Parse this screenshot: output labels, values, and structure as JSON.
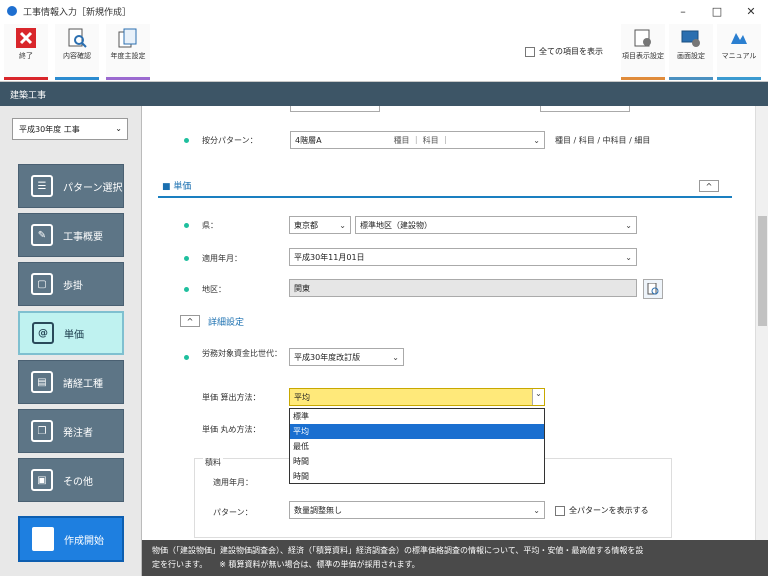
{
  "window": {
    "title": "工事情報入力［新規作成］",
    "controls": [
      "–",
      "□",
      "✕"
    ]
  },
  "toolbar": {
    "buttons": [
      {
        "label": "終了",
        "icon": "close-icon",
        "color": "#d9262b"
      },
      {
        "label": "内容確認",
        "icon": "preview-icon",
        "color": "#2b8bd0"
      },
      {
        "label": "年度主設定",
        "icon": "copy-settings-icon",
        "color": "#9b6ad0"
      }
    ],
    "show_all_label": "全ての項目を表示",
    "right_buttons": [
      {
        "label": "項目表示設定",
        "icon": "display-settings-icon",
        "color": "#e08b3a"
      },
      {
        "label": "画面設定",
        "icon": "screen-settings-icon",
        "color": "#4a90c0"
      },
      {
        "label": "マニュアル",
        "icon": "manual-icon",
        "color": "#3a9ad0"
      }
    ]
  },
  "section_header": "建築工事",
  "sidebar": {
    "year_select": "平成30年度 工事",
    "nav": [
      {
        "label": "パターン選択",
        "icon": "grid-icon"
      },
      {
        "label": "工事概要",
        "icon": "pencil-icon"
      },
      {
        "label": "歩掛",
        "icon": "page-icon"
      },
      {
        "label": "単価",
        "icon": "at-icon"
      },
      {
        "label": "諸経工種",
        "icon": "document-icon"
      },
      {
        "label": "発注者",
        "icon": "copy-icon"
      },
      {
        "label": "その他",
        "icon": "box-icon"
      }
    ],
    "create_button": "作成開始"
  },
  "content": {
    "ratio_pattern": {
      "label": "按分パターン：",
      "value": "4階層A",
      "options_text": "種目 ｜ 科目 ｜",
      "hint": "種目 / 科目 / 中科目 / 細目"
    },
    "tanka_section": {
      "title": "単価",
      "collapse": "^"
    },
    "prefecture": {
      "label": "県：",
      "value": "東京都",
      "region": "標準地区（建設物）"
    },
    "applied_month": {
      "label": "適用年月：",
      "value": "平成30年11月01日"
    },
    "area": {
      "label": "地区：",
      "value": "関東"
    },
    "detail_toggle": {
      "label": "詳細設定",
      "icon": "^"
    },
    "labor_gen": {
      "label": "労務対象資金比世代：",
      "value": "平成30年度改訂版"
    },
    "unit_calc": {
      "label": "単価 算出方法：",
      "value": "平均"
    },
    "unit_round": {
      "label": "単価 丸め方法："
    },
    "dropdown_options": [
      "標準",
      "平均",
      "最低",
      "時間",
      "時間"
    ],
    "dropdown_selected": 1,
    "group": {
      "title": "積料",
      "applied_month_label": "適用年月：",
      "pattern_label": "パターン：",
      "pattern_value": "数量調整無し",
      "show_all_patterns": "全パターンを表示する"
    }
  },
  "footer": {
    "line1": "物価（「建設物価」建設物価調査会）、経済（「積算資料」経済調査会）の標準価格調査の情報について、平均・安値・最高値する情報を設",
    "line2": "定を行います。　　※ 積算資料が無い場合は、標準の単価が採用されます。"
  }
}
